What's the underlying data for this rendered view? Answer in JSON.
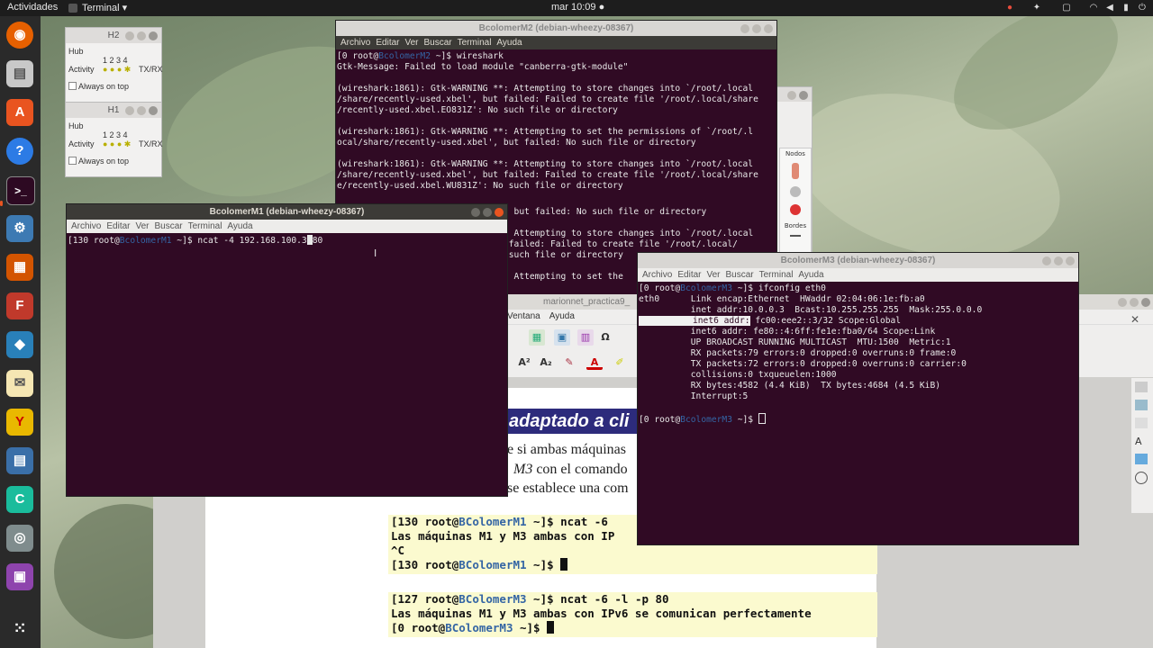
{
  "topbar": {
    "activities": "Actividades",
    "app_menu": "Terminal ▾",
    "clock": "mar 10:09 ●"
  },
  "hub_windows": [
    {
      "title": "H2",
      "hub_label": "Hub",
      "activity_label": "Activity",
      "ports": "1 2 3 4",
      "txrx": "TX/RX",
      "always_on_top": "Always on top"
    },
    {
      "title": "H1",
      "hub_label": "Hub",
      "activity_label": "Activity",
      "ports": "1 2 3 4",
      "txrx": "TX/RX",
      "always_on_top": "Always on top"
    }
  ],
  "term_m2": {
    "title": "BcolomerM2 (debian-wheezy-08367)",
    "menu": [
      "Archivo",
      "Editar",
      "Ver",
      "Buscar",
      "Terminal",
      "Ayuda"
    ],
    "prompt_pre": "[0 root@",
    "prompt_host": "BcolomerM2",
    "prompt_post": " ~]$ wireshark",
    "lines": [
      "Gtk-Message: Failed to load module \"canberra-gtk-module\"",
      "",
      "(wireshark:1861): Gtk-WARNING **: Attempting to store changes into `/root/.local",
      "/share/recently-used.xbel', but failed: Failed to create file '/root/.local/share",
      "/recently-used.xbel.EO831Z': No such file or directory",
      "",
      "(wireshark:1861): Gtk-WARNING **: Attempting to set the permissions of `/root/.l",
      "ocal/share/recently-used.xbel', but failed: No such file or directory",
      "",
      "(wireshark:1861): Gtk-WARNING **: Attempting to store changes into `/root/.local",
      "/share/recently-used.xbel', but failed: Failed to create file '/root/.local/share",
      "e/recently-used.xbel.WU831Z': No such file or directory"
    ],
    "hidden_tail": [
      ": but failed: No such file or directory",
      "",
      ": Attempting to store changes into `/root/.local",
      " failed: Failed to create file '/root/.local/",
      " such file or directory",
      "",
      ": Attempting to set the"
    ]
  },
  "term_m1": {
    "title": "BcolomerM1 (debian-wheezy-08367)",
    "menu": [
      "Archivo",
      "Editar",
      "Ver",
      "Buscar",
      "Terminal",
      "Ayuda"
    ],
    "prompt_pre": "[130 root@",
    "prompt_host": "BcolomerM1",
    "prompt_cmd": " ~]$ ncat -4 192.168.100.3",
    "prompt_tail": "80"
  },
  "term_m3": {
    "title": "BcolomerM3 (debian-wheezy-08367)",
    "menu": [
      "Archivo",
      "Editar",
      "Ver",
      "Buscar",
      "Terminal",
      "Ayuda"
    ],
    "prompt_pre": "[0 root@",
    "prompt_host": "BcolomerM3",
    "prompt_cmd": " ~]$ ifconfig eth0",
    "iface": "eth0",
    "l1": "Link encap:Ethernet  HWaddr 02:04:06:1e:fb:a0",
    "l2": "inet addr:10.0.0.3  Bcast:10.255.255.255  Mask:255.0.0.0",
    "l3_hl": "inet6 addr:",
    "l3_rest": " fc00:eee2::3/32 Scope:Global",
    "l4": "inet6 addr: fe80::4:6ff:fe1e:fba0/64 Scope:Link",
    "l5": "UP BROADCAST RUNNING MULTICAST  MTU:1500  Metric:1",
    "l6": "RX packets:79 errors:0 dropped:0 overruns:0 frame:0",
    "l7": "TX packets:72 errors:0 dropped:0 overruns:0 carrier:0",
    "l8": "collisions:0 txqueuelen:1000",
    "l9": "RX bytes:4582 (4.4 KiB)  TX bytes:4684 (4.5 KiB)",
    "l10": "Interrupt:5",
    "prompt2_cmd": " ~]$ "
  },
  "side_panel": {
    "nodes_label": "Nodos",
    "bordes_label": "Bordes"
  },
  "doc": {
    "title": "marionnet_practica9_",
    "menu": [
      "Ventana",
      "Ayuda"
    ],
    "heading": "adaptado a cli",
    "para1": "e si ambas máquinas",
    "para2_em": "M3",
    "para2": " con el comando",
    "para3": "se establece una com",
    "box1": [
      {
        "pre": "[130 root@",
        "host": "BColomerM1",
        "post": " ~]$ ncat -6"
      },
      {
        "text": "Las máquinas M1 y M3 ambas con IP"
      },
      {
        "text": "^C"
      },
      {
        "pre": "[130 root@",
        "host": "BColomerM1",
        "post": " ~]$ "
      }
    ],
    "box2": [
      {
        "pre": "[127 root@",
        "host": "BColomerM3",
        "post": " ~]$ ncat -6 -l -p 80"
      },
      {
        "text": "Las máquinas M1 y M3 ambas con IPv6 se comunican perfectamente"
      },
      {
        "pre": "[0 root@",
        "host": "BColomerM3",
        "post": " ~]$ "
      }
    ]
  }
}
